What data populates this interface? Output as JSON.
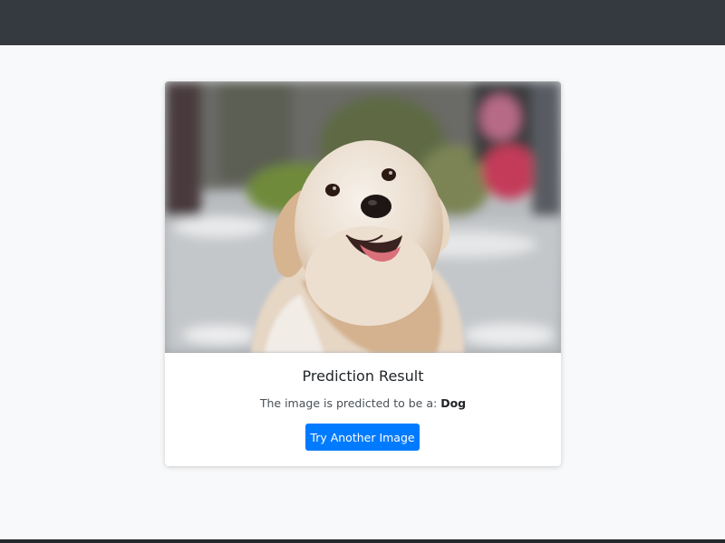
{
  "navbar": {},
  "card": {
    "image": "dog-photo",
    "title": "Prediction Result",
    "text_prefix": "The image is predicted to be a:",
    "prediction": "Dog",
    "button_label": "Try Another Image"
  },
  "colors": {
    "navbar_bg": "#343a40",
    "page_bg": "#f8f9fa",
    "button_bg": "#007bff"
  }
}
